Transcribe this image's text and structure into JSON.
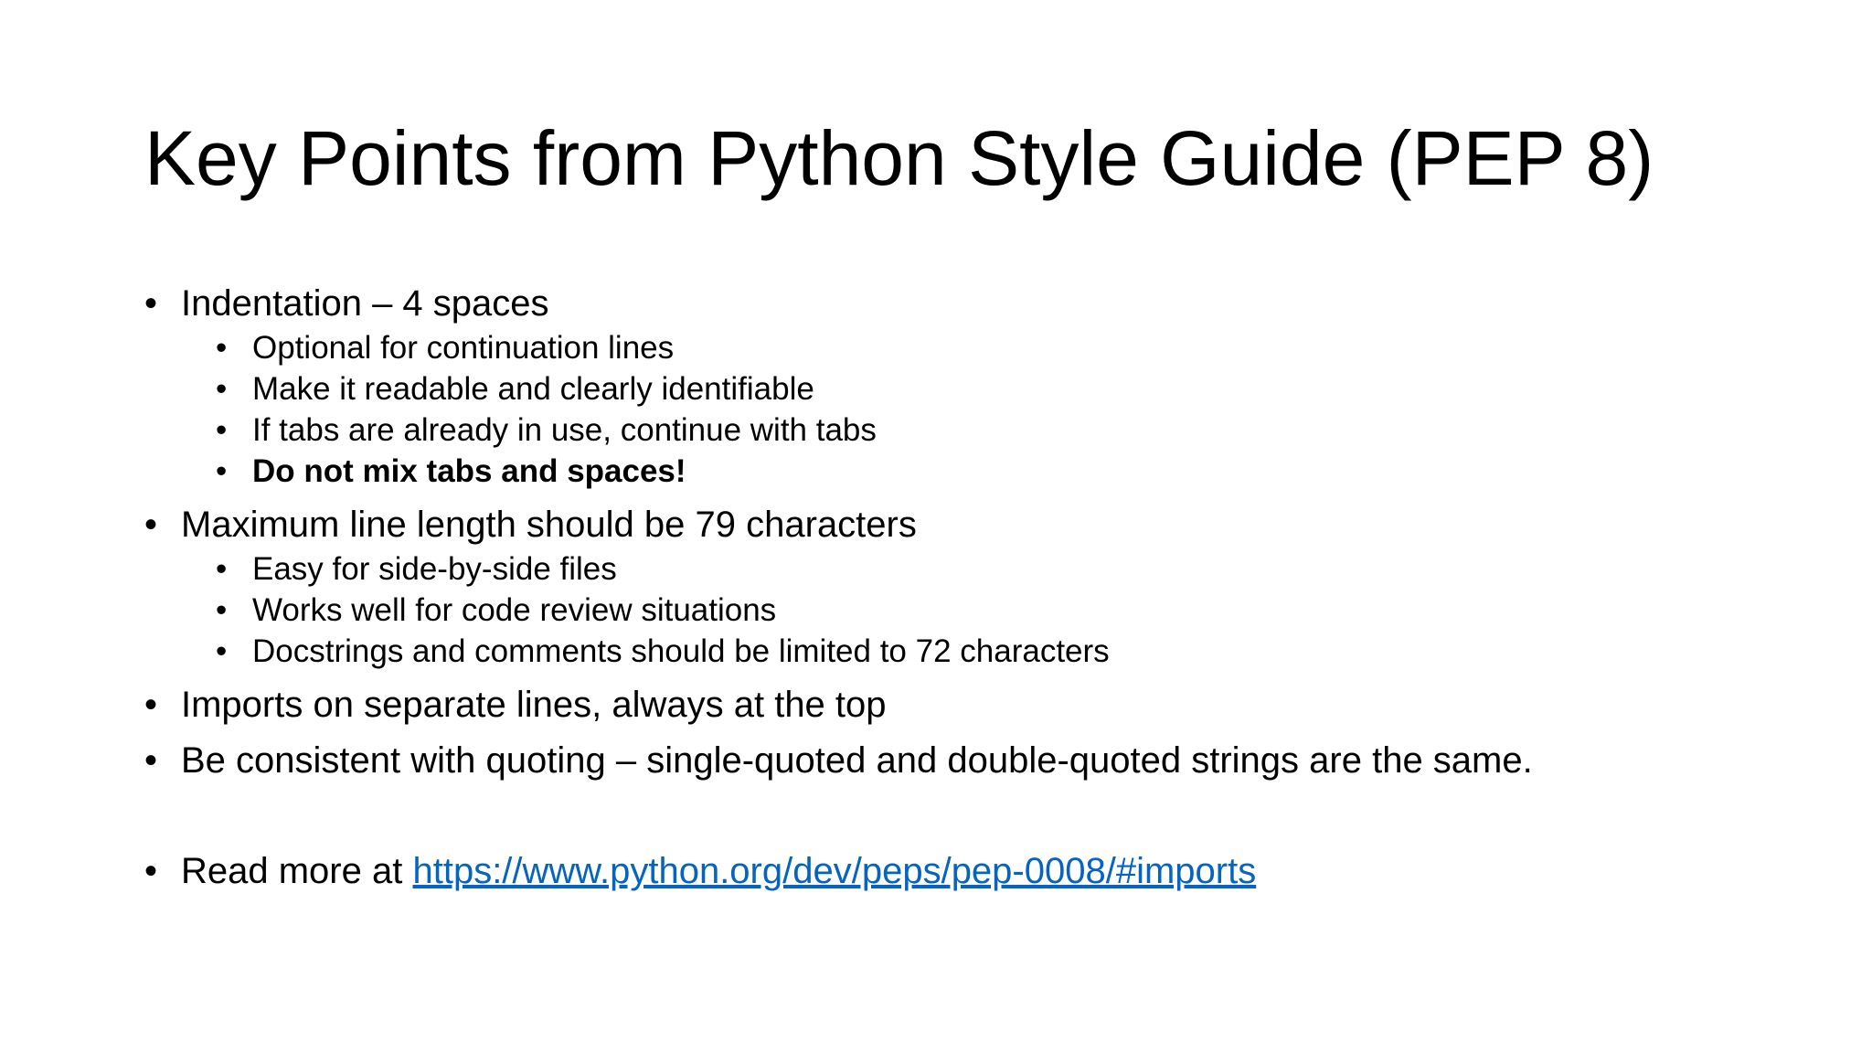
{
  "slide": {
    "title": "Key Points from Python Style Guide (PEP 8)",
    "bullet_char": "•",
    "items": [
      {
        "text": "Indentation – 4 spaces"
      },
      {
        "text": "Optional for continuation lines"
      },
      {
        "text": "Make it readable and clearly identifiable"
      },
      {
        "text": "If tabs are already in use, continue with tabs"
      },
      {
        "text": "Do not mix tabs and spaces!"
      },
      {
        "text": "Maximum line length should be 79 characters"
      },
      {
        "text": "Easy for side-by-side files"
      },
      {
        "text": "Works well for code review situations"
      },
      {
        "text": "Docstrings and comments should be limited to 72 characters"
      },
      {
        "text": "Imports on separate lines, always at the top"
      },
      {
        "text": "Be consistent with quoting – single-quoted and double-quoted strings are the same."
      },
      {
        "text": "Read more at ",
        "link_text": "https://www.python.org/dev/peps/pep-0008/#imports"
      }
    ],
    "colors": {
      "text": "#000000",
      "link": "#0563c1",
      "background": "#ffffff"
    }
  }
}
